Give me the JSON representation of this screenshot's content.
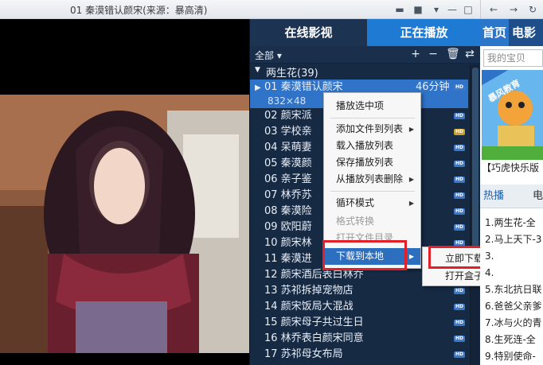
{
  "window": {
    "title": "01 秦漠错认颜宋(来源：暴高清)"
  },
  "tabs": {
    "online": "在线影视",
    "playing": "正在播放"
  },
  "toolbar": {
    "filter": "全部"
  },
  "group": {
    "title": "两生花(39)"
  },
  "playlist": {
    "selected": {
      "title": "01 秦漠错认颜宋",
      "duration": "46分钟",
      "resolution": "832×48"
    },
    "items": [
      "02 颜宋派",
      "03 学校亲",
      "04 呆萌妻",
      "05 秦漠颜",
      "06 亲子鉴",
      "07 林乔苏",
      "08 秦漠险",
      "09 欧阳蔚",
      "10 颜宋林",
      "11 秦漠进",
      "12 颜宋酒后表白林乔",
      "13 苏祁拆掉宠物店",
      "14 颜宋饭局大混战",
      "15 颜宋母子共过生日",
      "16 林乔表白颜宋同意",
      "17 苏祁母女布局"
    ],
    "hd_badge": "HD"
  },
  "context_menu": {
    "items": [
      {
        "label": "播放选中项",
        "submenu": false,
        "disabled": false
      },
      {
        "label": "添加文件到列表",
        "submenu": true,
        "disabled": false
      },
      {
        "label": "载入播放列表",
        "submenu": false,
        "disabled": false
      },
      {
        "label": "保存播放列表",
        "submenu": false,
        "disabled": false
      },
      {
        "label": "从播放列表删除",
        "submenu": true,
        "disabled": false
      },
      {
        "label": "循环模式",
        "submenu": true,
        "disabled": false
      },
      {
        "label": "格式转换",
        "submenu": false,
        "disabled": true
      },
      {
        "label": "打开文件目录",
        "submenu": false,
        "disabled": true
      },
      {
        "label": "下载到本地",
        "submenu": true,
        "disabled": false,
        "active": true
      }
    ]
  },
  "submenu": {
    "items": [
      "立即下载PC格式",
      "打开盒子查看其它格式"
    ]
  },
  "sidebar": {
    "tab_home": "首页",
    "tab_movie": "电影",
    "search_placeholder": "我的宝贝",
    "banner_text": "暴风教育",
    "banner_caption": "【巧虎快乐版",
    "tab_hot": "热播",
    "tab_other": "电",
    "hot_list": [
      "1.两生花-全",
      "2.马上天下-3",
      "3.",
      "4.",
      "5.东北抗日联",
      "6.爸爸父亲爹",
      "7.冰与火的青",
      "8.生死连-全",
      "9.特别使命-"
    ]
  },
  "colors": {
    "accent": "#1f7ad4",
    "selection": "#2f74c8",
    "menu_active": "#2d6fbf",
    "highlight": "#e3202a",
    "panel_bg": "#162a44"
  }
}
